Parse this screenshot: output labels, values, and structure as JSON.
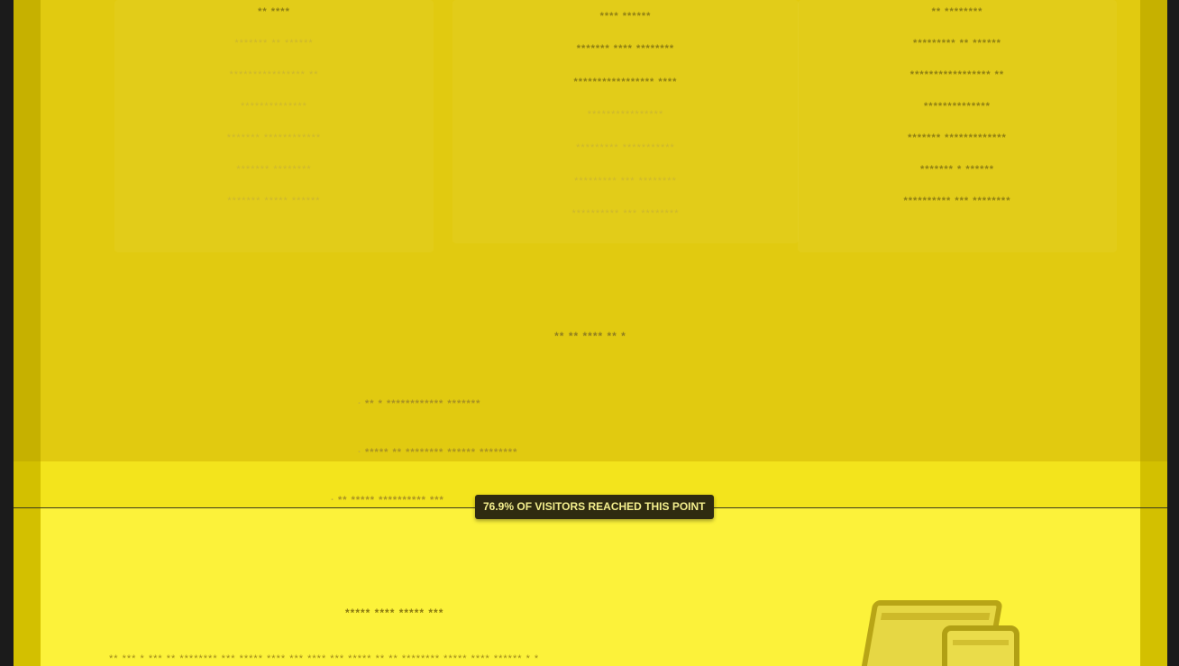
{
  "features": {
    "left": [
      "** ****",
      "******* ** ******",
      "**************** **",
      "**************",
      "******* ************",
      "******* ********",
      "******* ***** ******"
    ],
    "middle": [
      "**** ******",
      "******* **** ********",
      "***************** ****",
      "****************",
      "********* ***********",
      "********* *** ********",
      "********** *** ********"
    ],
    "right": [
      "** ********",
      "********* ** ******",
      "***************** **",
      "**************",
      "******* *************",
      "******* * ******",
      "********** *** ********"
    ]
  },
  "section": {
    "heading": "** ** **** ** *",
    "items": [
      "** * ************ *******",
      "***** ** ******** ****** ********",
      "** ***** ********** ***"
    ]
  },
  "scroll_indicator": {
    "label": "76.9% OF VISITORS REACHED THIS POINT",
    "percent": 76.9
  },
  "promo": {
    "heading": "***** **** ***** ***",
    "text": "** *** * *** ** ******** *** ***** **** *** **** *** ***** ** ** ******** ***** **** ****** * *"
  },
  "colors": {
    "heatmap_cold": "#c6b100",
    "heatmap_warm": "#fcf23a",
    "badge_bg": "#2f2b10",
    "badge_text": "#f3ee8d"
  }
}
